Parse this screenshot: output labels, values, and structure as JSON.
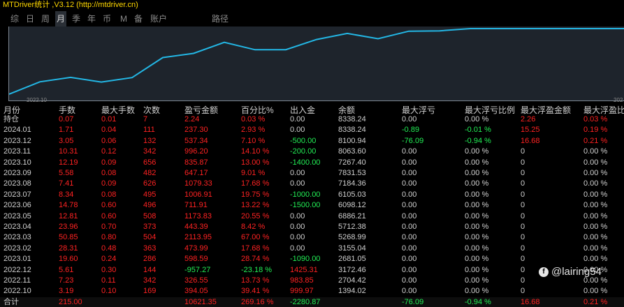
{
  "app": {
    "title": "MTDriver统计 ,V3.12 (http://mtdriver.cn)"
  },
  "tabs": [
    {
      "label": "综",
      "active": false
    },
    {
      "label": "日",
      "active": false
    },
    {
      "label": "周",
      "active": false
    },
    {
      "label": "月",
      "active": true
    },
    {
      "label": "季",
      "active": false
    },
    {
      "label": "年",
      "active": false
    },
    {
      "label": "币",
      "active": false
    },
    {
      "label": "M",
      "active": false
    },
    {
      "label": "备",
      "active": false
    },
    {
      "label": "账户",
      "active": false
    },
    {
      "label": "路径",
      "active": false
    }
  ],
  "chart_data": {
    "type": "line",
    "x_tick_labels": [
      "2022.10",
      "202"
    ],
    "series": [
      {
        "values": [
          1394.02,
          2704.42,
          3172.46,
          2681.05,
          3155.04,
          5268.99,
          5712.38,
          6886.21,
          6098.12,
          6105.03,
          7184.36,
          7831.53,
          7267.4,
          8063.6,
          8100.94,
          8338.24,
          8338.24,
          8338.24,
          8338.24,
          8338.24,
          8338.24
        ]
      }
    ],
    "color": "#23b7e5",
    "background": "#1e242c"
  },
  "table": {
    "headers": [
      "月份",
      "手数",
      "最大手数",
      "次数",
      "盈亏金额",
      "百分比%",
      "出入金",
      "余额",
      "最大浮亏",
      "最大浮亏比例",
      "最大浮盈金额",
      "最大浮盈比"
    ],
    "rows": [
      [
        "持仓",
        "0.07",
        "0.01",
        "7",
        "2.24",
        "0.03 %",
        "0.00",
        "8338.24",
        "0.00",
        "0.00 %",
        "2.26",
        "0.03 %"
      ],
      [
        "2024.01",
        "1.71",
        "0.04",
        "111",
        "237.30",
        "2.93 %",
        "0.00",
        "8338.24",
        "-0.89",
        "-0.01 %",
        "15.25",
        "0.19 %"
      ],
      [
        "2023.12",
        "3.05",
        "0.06",
        "132",
        "537.34",
        "7.10 %",
        "-500.00",
        "8100.94",
        "-76.09",
        "-0.94 %",
        "16.68",
        "0.21 %"
      ],
      [
        "2023.11",
        "10.31",
        "0.12",
        "342",
        "996.20",
        "14.10 %",
        "-200.00",
        "8063.60",
        "0.00",
        "0.00 %",
        "0",
        "0.00 %"
      ],
      [
        "2023.10",
        "12.19",
        "0.09",
        "656",
        "835.87",
        "13.00 %",
        "-1400.00",
        "7267.40",
        "0.00",
        "0.00 %",
        "0",
        "0.00 %"
      ],
      [
        "2023.09",
        "5.58",
        "0.08",
        "482",
        "647.17",
        "9.01 %",
        "0.00",
        "7831.53",
        "0.00",
        "0.00 %",
        "0",
        "0.00 %"
      ],
      [
        "2023.08",
        "7.41",
        "0.09",
        "626",
        "1079.33",
        "17.68 %",
        "0.00",
        "7184.36",
        "0.00",
        "0.00 %",
        "0",
        "0.00 %"
      ],
      [
        "2023.07",
        "8.34",
        "0.08",
        "495",
        "1006.91",
        "19.75 %",
        "-1000.00",
        "6105.03",
        "0.00",
        "0.00 %",
        "0",
        "0.00 %"
      ],
      [
        "2023.06",
        "14.78",
        "0.60",
        "496",
        "711.91",
        "13.22 %",
        "-1500.00",
        "6098.12",
        "0.00",
        "0.00 %",
        "0",
        "0.00 %"
      ],
      [
        "2023.05",
        "12.81",
        "0.60",
        "508",
        "1173.83",
        "20.55 %",
        "0.00",
        "6886.21",
        "0.00",
        "0.00 %",
        "0",
        "0.00 %"
      ],
      [
        "2023.04",
        "23.96",
        "0.70",
        "373",
        "443.39",
        "8.42 %",
        "0.00",
        "5712.38",
        "0.00",
        "0.00 %",
        "0",
        "0.00 %"
      ],
      [
        "2023.03",
        "50.85",
        "0.80",
        "504",
        "2113.95",
        "67.00 %",
        "0.00",
        "5268.99",
        "0.00",
        "0.00 %",
        "0",
        "0.00 %"
      ],
      [
        "2023.02",
        "28.31",
        "0.48",
        "363",
        "473.99",
        "17.68 %",
        "0.00",
        "3155.04",
        "0.00",
        "0.00 %",
        "0",
        "0.00 %"
      ],
      [
        "2023.01",
        "19.60",
        "0.24",
        "286",
        "598.59",
        "28.74 %",
        "-1090.00",
        "2681.05",
        "0.00",
        "0.00 %",
        "0",
        "0.00 %"
      ],
      [
        "2022.12",
        "5.61",
        "0.30",
        "144",
        "-957.27",
        "-23.18 %",
        "1425.31",
        "3172.46",
        "0.00",
        "0.00 %",
        "0",
        "0.00 %"
      ],
      [
        "2022.11",
        "7.23",
        "0.11",
        "342",
        "326.55",
        "13.73 %",
        "983.85",
        "2704.42",
        "0.00",
        "0.00 %",
        "0",
        "0.00 %"
      ],
      [
        "2022.10",
        "3.19",
        "0.10",
        "169",
        "394.05",
        "39.41 %",
        "999.97",
        "1394.02",
        "0.00",
        "0.00 %",
        "0",
        "0.00 %"
      ]
    ],
    "total": [
      "合计",
      "215.00",
      "",
      "",
      "10621.35",
      "269.16 %",
      "-2280.87",
      "",
      "-76.09",
      "-0.94 %",
      "16.68",
      "0.21 %"
    ]
  },
  "colors": {
    "header": "#d0d0d0",
    "label": "#d0d0d0",
    "value": "#d0d0d0",
    "positive": "#ff2222",
    "negative": "#22ee55"
  },
  "watermark": {
    "icon": "facebook-icon",
    "text": "@lairing54"
  }
}
